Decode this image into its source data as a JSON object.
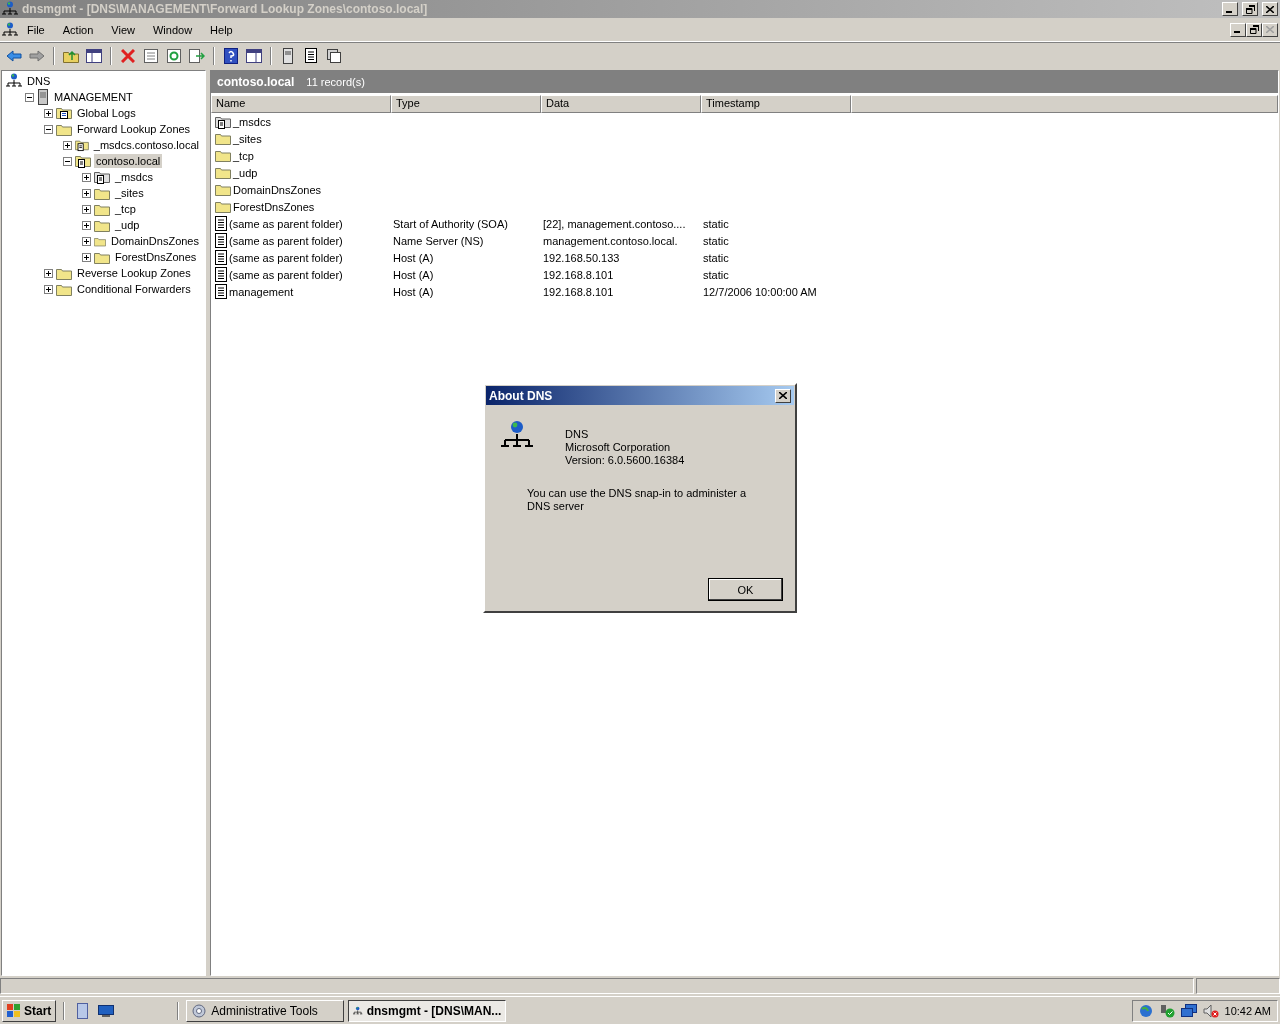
{
  "window": {
    "title": "dnsmgmt - [DNS\\MANAGEMENT\\Forward Lookup Zones\\contoso.local]"
  },
  "menu": [
    "File",
    "Action",
    "View",
    "Window",
    "Help"
  ],
  "tree": [
    {
      "label": "DNS",
      "kind": "dns",
      "selected": false,
      "children": [
        {
          "label": "MANAGEMENT",
          "kind": "server",
          "expanded": true,
          "selected": false,
          "children": [
            {
              "label": "Global Logs",
              "kind": "logs",
              "expanded": false,
              "selected": false
            },
            {
              "label": "Forward Lookup Zones",
              "kind": "folder",
              "expanded": true,
              "selected": false,
              "children": [
                {
                  "label": "_msdcs.contoso.local",
                  "kind": "zone",
                  "expanded": false,
                  "selected": false
                },
                {
                  "label": "contoso.local",
                  "kind": "zone",
                  "expanded": true,
                  "selected": true,
                  "children": [
                    {
                      "label": "_msdcs",
                      "kind": "delegation",
                      "expanded": false,
                      "selected": false
                    },
                    {
                      "label": "_sites",
                      "kind": "folder",
                      "expanded": false,
                      "selected": false
                    },
                    {
                      "label": "_tcp",
                      "kind": "folder",
                      "expanded": false,
                      "selected": false
                    },
                    {
                      "label": "_udp",
                      "kind": "folder",
                      "expanded": false,
                      "selected": false
                    },
                    {
                      "label": "DomainDnsZones",
                      "kind": "folder",
                      "expanded": false,
                      "selected": false
                    },
                    {
                      "label": "ForestDnsZones",
                      "kind": "folder",
                      "expanded": false,
                      "selected": false
                    }
                  ]
                }
              ]
            },
            {
              "label": "Reverse Lookup Zones",
              "kind": "folder",
              "expanded": false,
              "selected": false
            },
            {
              "label": "Conditional Forwarders",
              "kind": "folder",
              "expanded": false,
              "selected": false
            }
          ]
        }
      ]
    }
  ],
  "pane": {
    "title": "contoso.local",
    "count": "11 record(s)"
  },
  "columns": [
    "Name",
    "Type",
    "Data",
    "Timestamp"
  ],
  "rows": [
    {
      "kind": "delegation",
      "name": "_msdcs"
    },
    {
      "kind": "folder",
      "name": "_sites"
    },
    {
      "kind": "folder",
      "name": "_tcp"
    },
    {
      "kind": "folder",
      "name": "_udp"
    },
    {
      "kind": "folder",
      "name": "DomainDnsZones"
    },
    {
      "kind": "folder",
      "name": "ForestDnsZones"
    },
    {
      "kind": "record",
      "name": "(same as parent folder)",
      "type": "Start of Authority (SOA)",
      "data": "[22], management.contoso....",
      "timestamp": "static"
    },
    {
      "kind": "record",
      "name": "(same as parent folder)",
      "type": "Name Server (NS)",
      "data": "management.contoso.local.",
      "timestamp": "static"
    },
    {
      "kind": "record",
      "name": "(same as parent folder)",
      "type": "Host (A)",
      "data": "192.168.50.133",
      "timestamp": "static"
    },
    {
      "kind": "record",
      "name": "(same as parent folder)",
      "type": "Host (A)",
      "data": "192.168.8.101",
      "timestamp": "static"
    },
    {
      "kind": "record",
      "name": "management",
      "type": "Host (A)",
      "data": "192.168.8.101",
      "timestamp": "12/7/2006 10:00:00 AM"
    }
  ],
  "dialog": {
    "title": "About DNS",
    "product": "DNS",
    "company": "Microsoft Corporation",
    "version": "Version: 6.0.5600.16384",
    "description": "You can use the DNS snap-in to administer a DNS server",
    "button": "OK"
  },
  "taskbar": {
    "start": "Start",
    "tasks": [
      {
        "label": "Administrative Tools",
        "kind": "tools",
        "selected": false
      },
      {
        "label": "dnsmgmt - [DNS\\MAN...",
        "kind": "dns",
        "selected": true
      }
    ],
    "clock": "10:42 AM"
  }
}
